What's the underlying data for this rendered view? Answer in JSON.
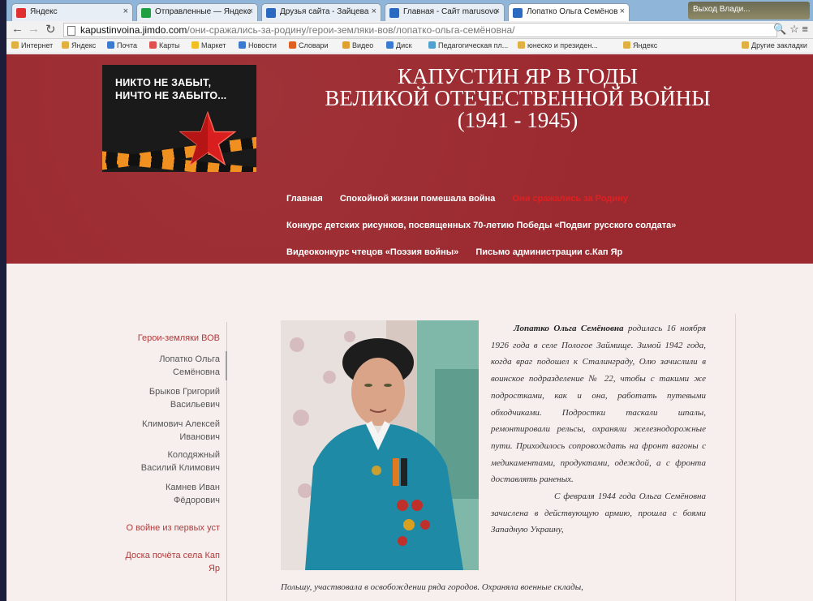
{
  "browser": {
    "tabs": [
      {
        "label": "Яндекс",
        "color": "#e03030"
      },
      {
        "label": "Отправленные — Яндекс",
        "color": "#20a040"
      },
      {
        "label": "Друзья сайта - Зайцева",
        "color": "#2a6ac0"
      },
      {
        "label": "Главная - Сайт marusovo",
        "color": "#2a6ac0"
      },
      {
        "label": "Лопатко Ольга Семёнов",
        "color": "#2a6ac0"
      }
    ],
    "profile": "Выход Влади...",
    "url_host": "kapustinvoina.jimdo.com",
    "url_path": "/они-сражались-за-родину/герои-земляки-вов/лопатко-ольга-семёновна/",
    "bookmarks": [
      {
        "label": "Интернет",
        "color": "#e0b040"
      },
      {
        "label": "Яндекс",
        "color": "#e0b040"
      },
      {
        "label": "Почта",
        "color": "#3a7ad0"
      },
      {
        "label": "Карты",
        "color": "#e05050"
      },
      {
        "label": "Маркет",
        "color": "#f0c020"
      },
      {
        "label": "Новости",
        "color": "#3a7ad0"
      },
      {
        "label": "Словари",
        "color": "#e06020"
      },
      {
        "label": "Видео",
        "color": "#e0a030"
      },
      {
        "label": "Диск",
        "color": "#3a7ad0"
      },
      {
        "label": "Педагогическая пл...",
        "color": "#50a0d0"
      },
      {
        "label": "юнеско и президен...",
        "color": "#e0b040"
      },
      {
        "label": "Яндекс",
        "color": "#e0b040"
      }
    ],
    "other_bookmarks": "Другие закладки"
  },
  "header": {
    "logo_line1": "НИКТО НЕ ЗАБЫТ,",
    "logo_line2": "НИЧТО НЕ ЗАБЫТО...",
    "title_line1": "КАПУСТИН ЯР В ГОДЫ",
    "title_line2": "ВЕЛИКОЙ ОТЕЧЕСТВЕННОЙ ВОЙНЫ",
    "title_line3": "(1941 - 1945)"
  },
  "nav": {
    "row1": [
      "Главная",
      "Спокойной жизни помешала война",
      "Они сражались за Родину"
    ],
    "row2": "Конкурс детских рисунков, посвященных 70-летию Победы «Подвиг русского солдата»",
    "row3": [
      "Видеоконкурс чтецов «Поэзия войны»",
      "Письмо администрации с.Кап Яр"
    ]
  },
  "sidebar": {
    "section": "Герои-земляки ВОВ",
    "items": [
      {
        "line1": "Лопатко Ольга",
        "line2": "Семёновна"
      },
      {
        "line1": "Брыков Григорий",
        "line2": "Васильевич"
      },
      {
        "line1": "Климович Алексей",
        "line2": "Иванович"
      },
      {
        "line1": "Колодяжный",
        "line2": "Василий Климович"
      },
      {
        "line1": "Камнев Иван",
        "line2": "Фёдорович"
      }
    ],
    "section2": "О войне из первых уст",
    "section3_line1": "Доска почёта села Кап",
    "section3_line2": "Яр"
  },
  "article": {
    "name": "Лопатко Ольга Семёновна",
    "p1": " родилась 16 ноября 1926 года в селе Пологое Займище. Зимой 1942 года, когда враг подошел к Сталинграду, Олю зачислили в воинское подразделение № 22, чтобы с такими же подростками, как и она, работать путевыми обходчиками. Подростки таскали шпалы, ремонтировали рельсы, охраняли железнодорожные пути. Приходилось сопровождать на фронт вагоны с медикаментами, продуктами, одеждой, а с фронта доставлять раненых.",
    "p2": "С февраля 1944 года Ольга Семёновна зачислена в действующую армию, прошла с боями Западную Украину,",
    "p3": "Польшу, участвовала в освобождении ряда городов. Охраняла военные склады,"
  }
}
